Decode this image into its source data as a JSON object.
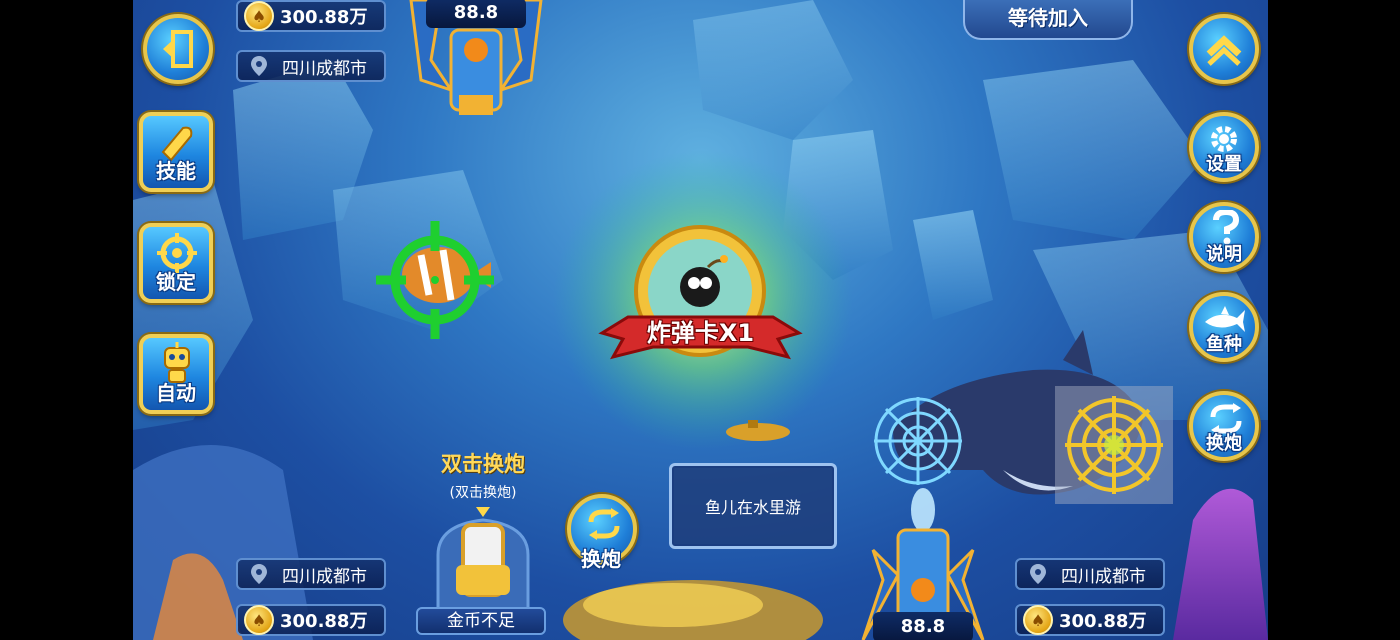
{
  "top_bar": {
    "wait_join": "等待加入",
    "top_gun_value": "88.8"
  },
  "players": {
    "top_left": {
      "coins": "300.88万",
      "location": "四川成都市"
    },
    "bottom_left": {
      "coins": "300.88万",
      "location": "四川成都市",
      "status": "金币不足"
    },
    "bottom_right": {
      "coins": "300.88万",
      "location": "四川成都市",
      "gun_value": "88.8"
    }
  },
  "left_menu": {
    "skill": "技能",
    "lock": "锁定",
    "auto": "自动"
  },
  "right_menu": {
    "settings": "设置",
    "help": "说明",
    "fish_types": "鱼种",
    "swap_cannon": "换炮"
  },
  "center": {
    "bomb_card": "炸弹卡X1",
    "message": "鱼儿在水里游"
  },
  "cannon_hint": {
    "title": "双击换炮",
    "subtitle": "(双击换炮)",
    "swap_label": "换炮"
  },
  "colors": {
    "accent_gold": "#f0cf55",
    "button_blue": "#1e86e0",
    "ribbon_red": "#d42a2a"
  }
}
